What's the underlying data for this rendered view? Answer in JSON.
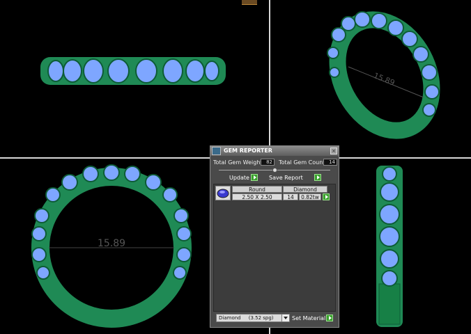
{
  "viewports": {
    "measure_top_right": "15.89",
    "measure_bottom_left": "15.89"
  },
  "panel": {
    "title": "GEM REPORTER",
    "close_glyph": "×",
    "total_weight_label": "Total Gem Weight",
    "total_weight_value": "82",
    "total_count_label": "Total Gem Count",
    "total_count_value": "14",
    "update_label": "Update",
    "save_label": "Save Report",
    "table": {
      "headers": [
        "Round",
        "Diamond"
      ],
      "size": "2.50 X 2.50",
      "count": "14",
      "weight": "0.82tw"
    },
    "material_select": "Diamond     (3.52 spg)",
    "set_material_label": "Set Material"
  },
  "colors": {
    "metal": "#1f8a55",
    "gem": "#7ea6ff",
    "background": "#000000"
  }
}
